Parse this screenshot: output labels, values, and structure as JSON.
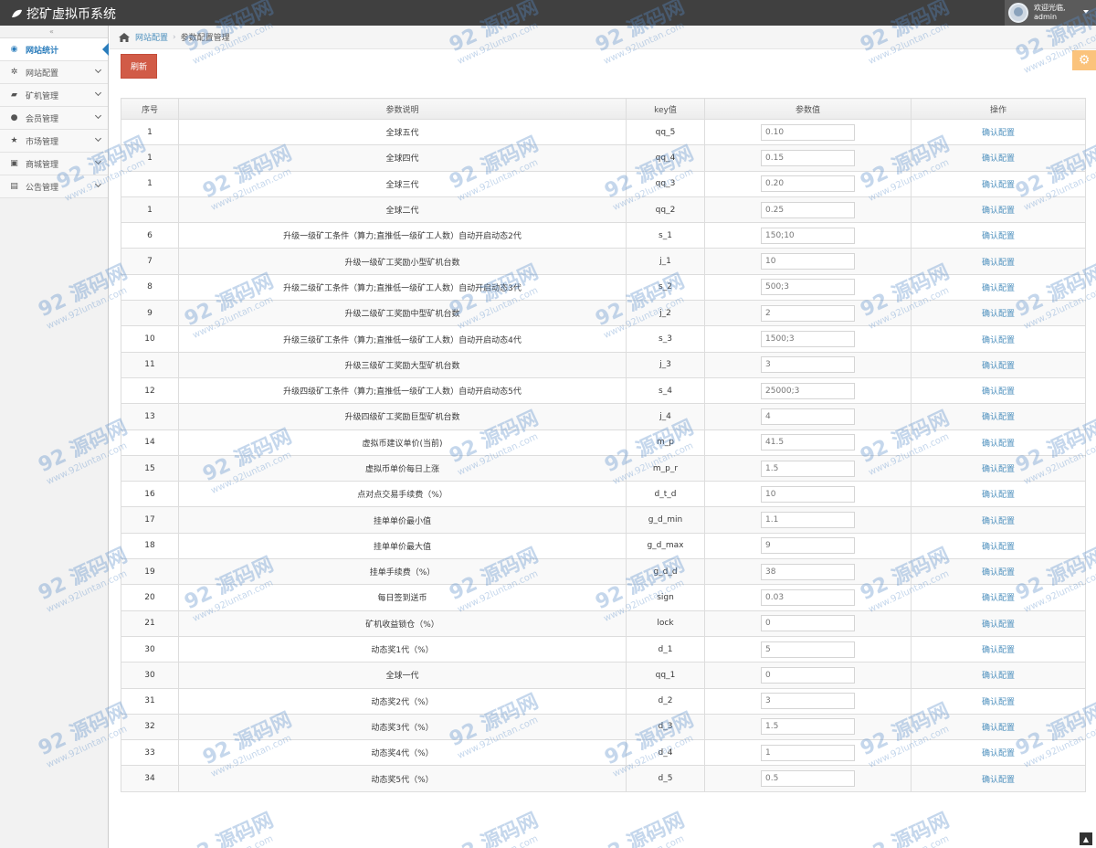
{
  "app": {
    "title": "挖矿虚拟币系统"
  },
  "user": {
    "greeting": "欢迎光临,",
    "name": "admin"
  },
  "sidebar": {
    "items": [
      {
        "label": "网站统计",
        "icon": "dashboard-icon",
        "glyph": "◉",
        "active": true,
        "arrow": false
      },
      {
        "label": "网站配置",
        "icon": "gear-icon",
        "glyph": "✲",
        "active": false,
        "arrow": true
      },
      {
        "label": "矿机管理",
        "icon": "folder-icon",
        "glyph": "▰",
        "active": false,
        "arrow": true
      },
      {
        "label": "会员管理",
        "icon": "users-icon",
        "glyph": "●",
        "active": false,
        "arrow": true
      },
      {
        "label": "市场管理",
        "icon": "star-icon",
        "glyph": "★",
        "active": false,
        "arrow": true
      },
      {
        "label": "商城管理",
        "icon": "cart-icon",
        "glyph": "▣",
        "active": false,
        "arrow": true
      },
      {
        "label": "公告管理",
        "icon": "file-icon",
        "glyph": "▤",
        "active": false,
        "arrow": true
      }
    ]
  },
  "breadcrumb": {
    "link": "网站配置",
    "current": "参数配置管理"
  },
  "toolbar": {
    "refresh_label": "刷新"
  },
  "table": {
    "headers": [
      "序号",
      "参数说明",
      "key值",
      "参数值",
      "操作"
    ],
    "action_label": "确认配置",
    "rows": [
      {
        "id": "1",
        "desc": "全球五代",
        "key": "qq_5",
        "value": "0.10"
      },
      {
        "id": "1",
        "desc": "全球四代",
        "key": "qq_4",
        "value": "0.15"
      },
      {
        "id": "1",
        "desc": "全球三代",
        "key": "qq_3",
        "value": "0.20"
      },
      {
        "id": "1",
        "desc": "全球二代",
        "key": "qq_2",
        "value": "0.25"
      },
      {
        "id": "6",
        "desc": "升级一级矿工条件（算力;直推低一级矿工人数）自动开启动态2代",
        "key": "s_1",
        "value": "150;10"
      },
      {
        "id": "7",
        "desc": "升级一级矿工奖励小型矿机台数",
        "key": "j_1",
        "value": "10"
      },
      {
        "id": "8",
        "desc": "升级二级矿工条件（算力;直推低一级矿工人数）自动开启动态3代",
        "key": "s_2",
        "value": "500;3"
      },
      {
        "id": "9",
        "desc": "升级二级矿工奖励中型矿机台数",
        "key": "j_2",
        "value": "2"
      },
      {
        "id": "10",
        "desc": "升级三级矿工条件（算力;直推低一级矿工人数）自动开启动态4代",
        "key": "s_3",
        "value": "1500;3"
      },
      {
        "id": "11",
        "desc": "升级三级矿工奖励大型矿机台数",
        "key": "j_3",
        "value": "3"
      },
      {
        "id": "12",
        "desc": "升级四级矿工条件（算力;直推低一级矿工人数）自动开启动态5代",
        "key": "s_4",
        "value": "25000;3"
      },
      {
        "id": "13",
        "desc": "升级四级矿工奖励巨型矿机台数",
        "key": "j_4",
        "value": "4"
      },
      {
        "id": "14",
        "desc": "虚拟币建议单价(当前)",
        "key": "m_p",
        "value": "41.5"
      },
      {
        "id": "15",
        "desc": "虚拟币单价每日上涨",
        "key": "m_p_r",
        "value": "1.5"
      },
      {
        "id": "16",
        "desc": "点对点交易手续费（%）",
        "key": "d_t_d",
        "value": "10"
      },
      {
        "id": "17",
        "desc": "挂单单价最小值",
        "key": "g_d_min",
        "value": "1.1"
      },
      {
        "id": "18",
        "desc": "挂单单价最大值",
        "key": "g_d_max",
        "value": "9"
      },
      {
        "id": "19",
        "desc": "挂单手续费（%）",
        "key": "g_d_d",
        "value": "38"
      },
      {
        "id": "20",
        "desc": "每日签到送币",
        "key": "sign",
        "value": "0.03"
      },
      {
        "id": "21",
        "desc": "矿机收益锁仓（%）",
        "key": "lock",
        "value": "0"
      },
      {
        "id": "30",
        "desc": "动态奖1代（%）",
        "key": "d_1",
        "value": "5"
      },
      {
        "id": "30",
        "desc": "全球一代",
        "key": "qq_1",
        "value": "0"
      },
      {
        "id": "31",
        "desc": "动态奖2代（%）",
        "key": "d_2",
        "value": "3"
      },
      {
        "id": "32",
        "desc": "动态奖3代（%）",
        "key": "d_3",
        "value": "1.5"
      },
      {
        "id": "33",
        "desc": "动态奖4代（%）",
        "key": "d_4",
        "value": "1"
      },
      {
        "id": "34",
        "desc": "动态奖5代（%）",
        "key": "d_5",
        "value": "0.5"
      }
    ]
  },
  "watermark": {
    "brand": "92 源码网",
    "url": "www.92luntan.com"
  },
  "colors": {
    "topbar": "#404040",
    "accent": "#2b7dbc",
    "refresh": "#d15b47",
    "link": "#4c8fbd"
  }
}
